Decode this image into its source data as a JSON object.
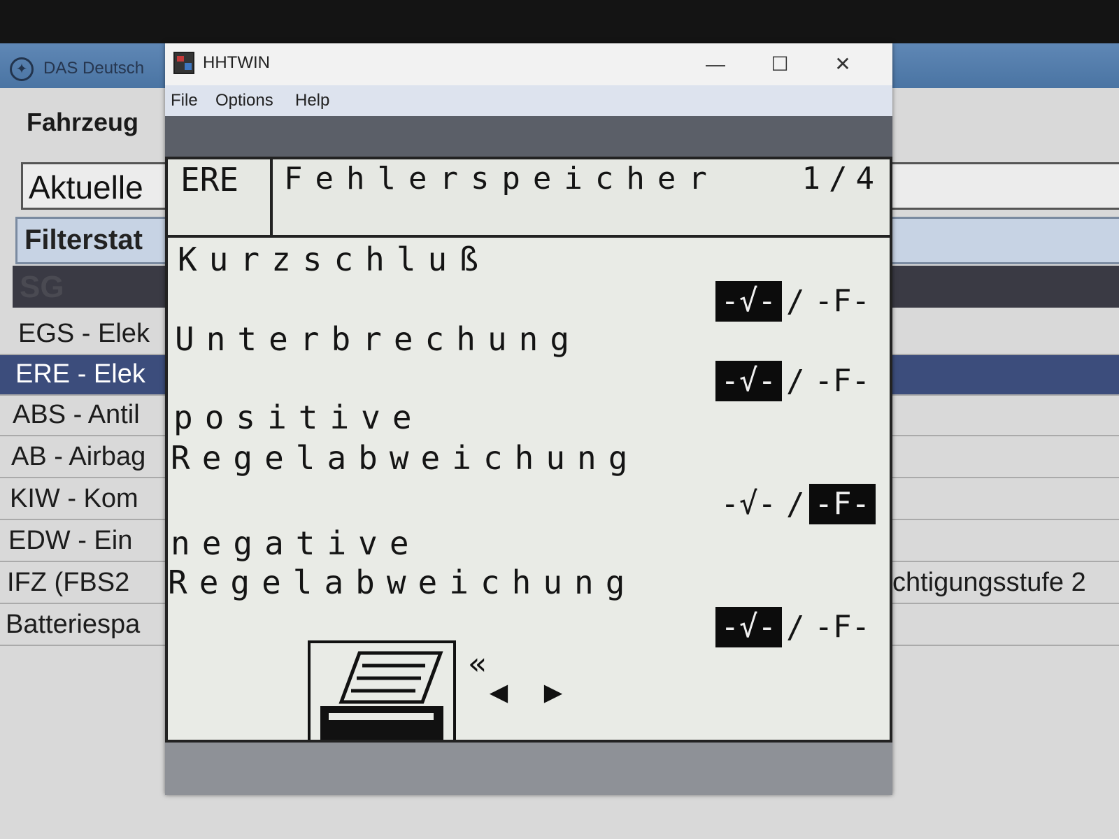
{
  "background_window": {
    "title": "DAS Deutsch",
    "heading": "Fahrzeug",
    "current_label": "Aktuelle",
    "filter_label": "Filterstat",
    "table_header": "SG",
    "rows": [
      {
        "left": "EGS - Elek",
        "right": "",
        "selected": false
      },
      {
        "left": "ERE - Elek",
        "right": "",
        "selected": true
      },
      {
        "left": "ABS - Antil",
        "right": "",
        "selected": false
      },
      {
        "left": "AB - Airbag",
        "right": "",
        "selected": false
      },
      {
        "left": "KIW - Kom",
        "right": "",
        "selected": false
      },
      {
        "left": "EDW - Ein",
        "right": "",
        "selected": false
      },
      {
        "left": "IFZ (FBS2",
        "right": "chtigungsstufe 2",
        "selected": false
      },
      {
        "left": "Batteriespa",
        "right": "",
        "selected": false
      }
    ]
  },
  "hhtwin": {
    "title": "HHTWIN",
    "window_buttons": {
      "minimize": "—",
      "maximize": "☐",
      "close": "✕"
    },
    "menu": [
      "File",
      "Options",
      "Help"
    ],
    "screen": {
      "ecu": "ERE",
      "title": "Fehlerspeicher",
      "page": "1/4",
      "faults": [
        {
          "label_lines": [
            "Kurzschluß"
          ],
          "ok_text": "-√-",
          "separator": "/",
          "fault_text": "-F-",
          "selected": "ok"
        },
        {
          "label_lines": [
            "Unterbrechung"
          ],
          "ok_text": "-√-",
          "separator": "/",
          "fault_text": "-F-",
          "selected": "ok"
        },
        {
          "label_lines": [
            "positive",
            "Regelabweichung"
          ],
          "ok_text": "-√-",
          "separator": "/",
          "fault_text": "-F-",
          "selected": "fault"
        },
        {
          "label_lines": [
            "negative",
            "Regelabweichung"
          ],
          "ok_text": "-√-",
          "separator": "/",
          "fault_text": "-F-",
          "selected": "ok"
        }
      ],
      "nav": {
        "back": "«",
        "prev": "◀",
        "next": "▶"
      }
    }
  }
}
